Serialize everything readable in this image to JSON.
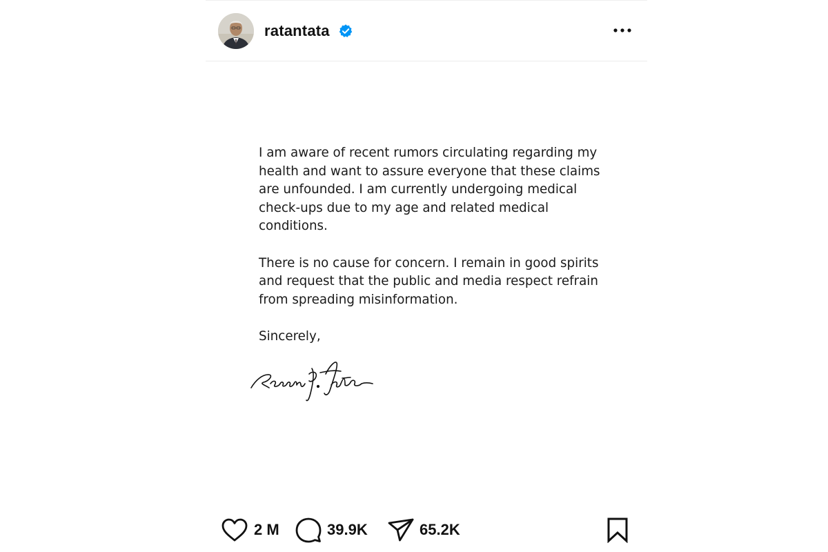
{
  "post": {
    "username": "ratantata",
    "verified": true,
    "icons": {
      "avatar": "profile-photo",
      "verified": "verified-badge-icon",
      "more": "more-options-icon",
      "like": "heart-icon",
      "comment": "comment-bubble-icon",
      "share": "paper-plane-icon",
      "save": "bookmark-icon"
    },
    "colors": {
      "verified_badge": "#0095f6",
      "text": "#111111",
      "background": "#ffffff"
    }
  },
  "letter": {
    "paragraphs": [
      "I am aware of recent rumors circulating regarding my health and want to assure everyone that these claims are unfounded. I am currently undergoing medical check-ups due to my age and related medical conditions.",
      "There is no cause for concern. I remain in good spirits and request that the public and media respect refrain from spreading misinformation.",
      "Sincerely,"
    ],
    "signature": "Ratan N. Tata"
  },
  "actions": {
    "likes": "2 M",
    "comments": "39.9K",
    "shares": "65.2K"
  }
}
